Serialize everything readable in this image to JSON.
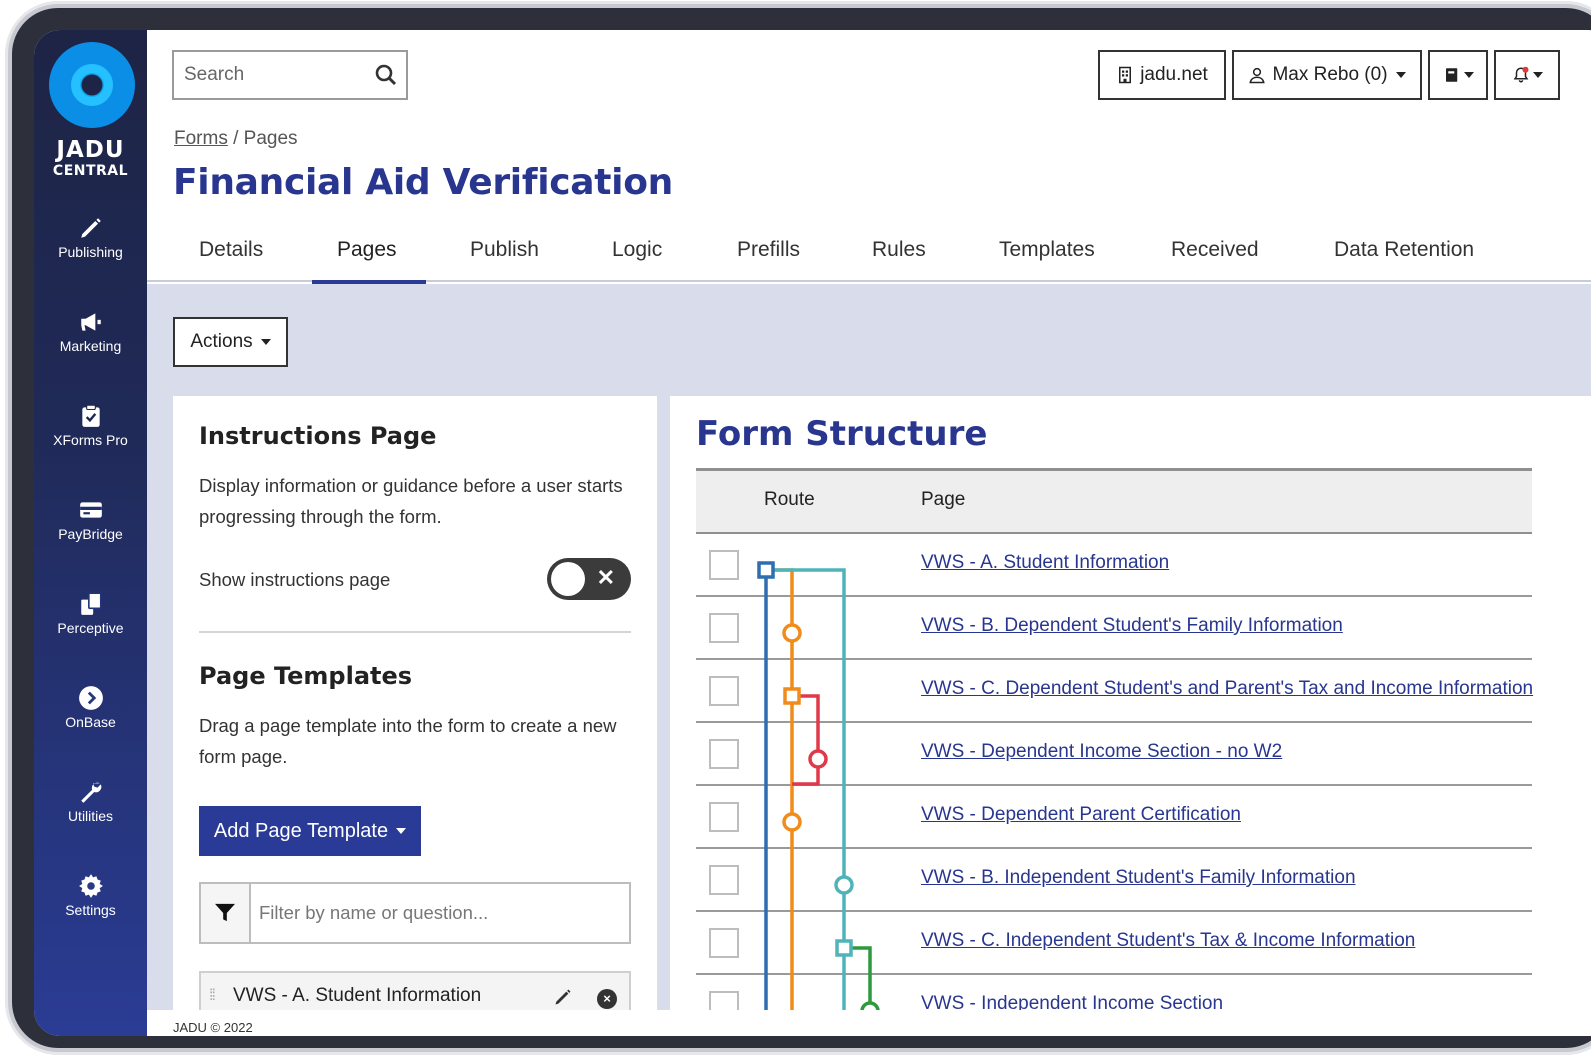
{
  "app": {
    "brand_line1": "JADU",
    "brand_line2": "CENTRAL",
    "footer": "JADU © 2022"
  },
  "sidebar": {
    "items": [
      {
        "label": "Publishing",
        "icon": "pencil-icon"
      },
      {
        "label": "Marketing",
        "icon": "megaphone-icon"
      },
      {
        "label": "XForms Pro",
        "icon": "clipboard-check-icon"
      },
      {
        "label": "PayBridge",
        "icon": "credit-card-icon"
      },
      {
        "label": "Perceptive",
        "icon": "copy-icon"
      },
      {
        "label": "OnBase",
        "icon": "chevron-circle-right-icon"
      },
      {
        "label": "Utilities",
        "icon": "wrench-icon"
      },
      {
        "label": "Settings",
        "icon": "gear-icon"
      }
    ]
  },
  "header": {
    "search_placeholder": "Search",
    "site_label": "jadu.net",
    "user_label": "Max Rebo (0)"
  },
  "breadcrumb": {
    "parent": "Forms",
    "separator": "/",
    "current": "Pages"
  },
  "page_title": "Financial Aid Verification",
  "tabs": [
    "Details",
    "Pages",
    "Publish",
    "Logic",
    "Prefills",
    "Rules",
    "Templates",
    "Received",
    "Data Retention"
  ],
  "active_tab": "Pages",
  "toolbar": {
    "actions_label": "Actions"
  },
  "instructions": {
    "heading": "Instructions Page",
    "description": "Display information or guidance before a user starts progressing through the form.",
    "toggle_label": "Show instructions page",
    "toggle_on": false
  },
  "templates": {
    "heading": "Page Templates",
    "description": "Drag a page template into the form to create a new form page.",
    "add_label": "Add Page Template",
    "filter_placeholder": "Filter by name or question...",
    "items": [
      "VWS - A. Student Information"
    ]
  },
  "form_structure": {
    "title": "Form Structure",
    "col_route": "Route",
    "col_page": "Page",
    "rows": [
      "VWS - A. Student Information",
      "VWS - B. Dependent Student's Family Information",
      "VWS - C. Dependent Student's and Parent's Tax and Income Information",
      "VWS - Dependent Income Section - no W2",
      "VWS - Dependent Parent Certification",
      "VWS - B. Independent Student's Family Information",
      "VWS - C. Independent Student's Tax & Income Information",
      "VWS - Independent Income Section"
    ],
    "route_colors": {
      "blue": "#2f6db0",
      "orange": "#f08c1a",
      "red": "#e0394a",
      "teal": "#4fb3b8",
      "green": "#2e9a3e"
    }
  }
}
